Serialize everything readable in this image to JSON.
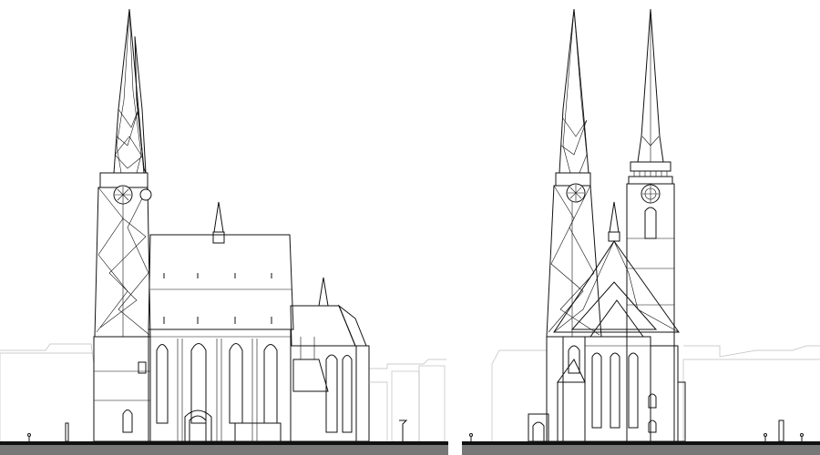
{
  "panels": [
    {
      "view": "side-elevation"
    },
    {
      "view": "front-elevation"
    }
  ],
  "colors": {
    "background": "#ffffff",
    "line": "#111111",
    "context_buildings": "#bdbdbd",
    "ground_strip": "#777777"
  },
  "icons": [
    "clock-icon",
    "human-figure-icon",
    "street-lamp-icon"
  ]
}
